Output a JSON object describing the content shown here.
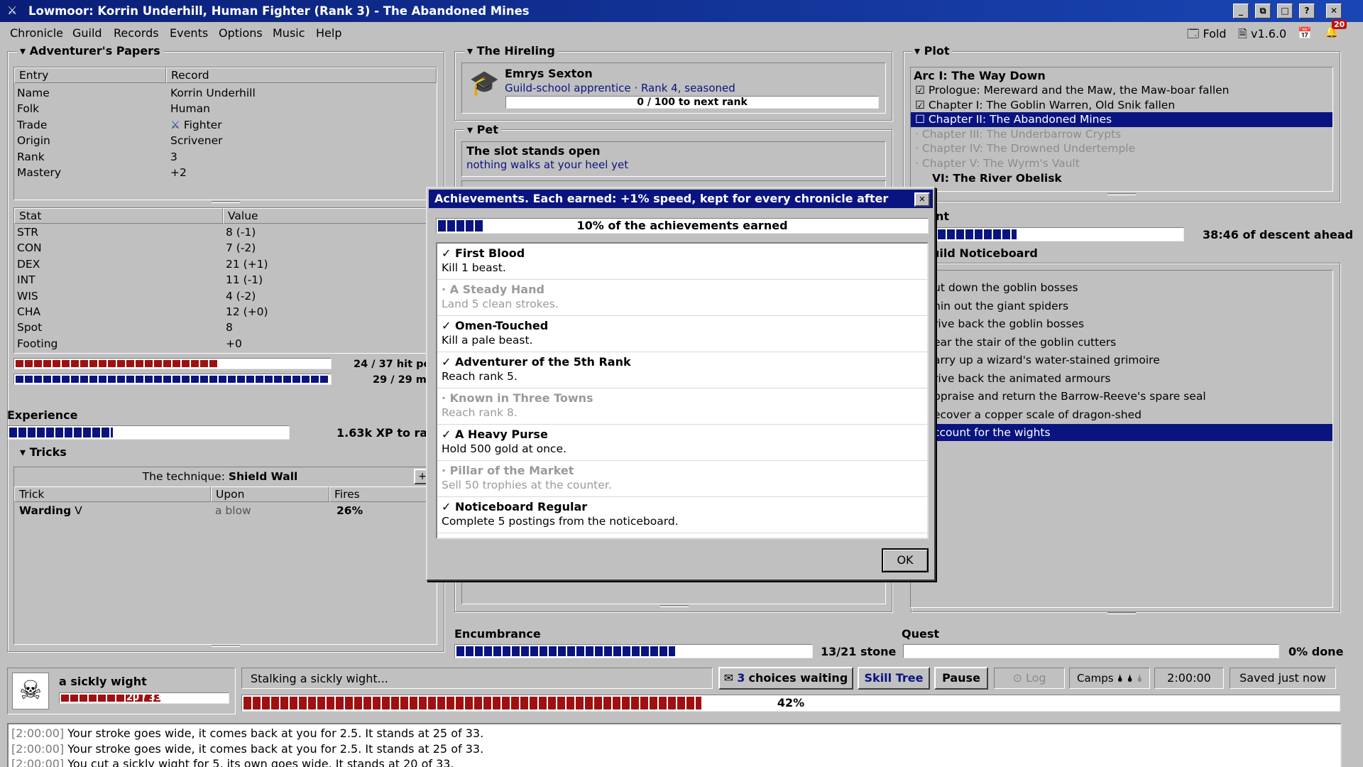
{
  "window": {
    "title": "Lowmoor: Korrin Underhill, Human Fighter (Rank 3) - The Abandoned Mines",
    "buttons": [
      "_",
      "⧉",
      "□",
      "?",
      "✕"
    ],
    "notification_count": "20"
  },
  "menu": [
    "Chronicle",
    "Guild",
    "Records",
    "Events",
    "Options",
    "Music",
    "Help"
  ],
  "menu_right": {
    "fold": "Fold",
    "version": "v1.6.0"
  },
  "papers": {
    "title": "Adventurer's Papers",
    "headers": [
      "Entry",
      "Record"
    ],
    "rows": [
      [
        "Name",
        "Korrin Underhill"
      ],
      [
        "Folk",
        "Human"
      ],
      [
        "Trade",
        "Fighter"
      ],
      [
        "Origin",
        "Scrivener"
      ],
      [
        "Rank",
        "3"
      ],
      [
        "Mastery",
        "+2"
      ]
    ]
  },
  "stats": {
    "headers": [
      "Stat",
      "Value"
    ],
    "rows": [
      [
        "STR",
        "8 (-1)"
      ],
      [
        "CON",
        "7 (-2)"
      ],
      [
        "DEX",
        "21 (+1)"
      ],
      [
        "INT",
        "11 (-1)"
      ],
      [
        "WIS",
        "4 (-2)"
      ],
      [
        "CHA",
        "12 (+0)"
      ],
      [
        "Spot",
        "8"
      ],
      [
        "Footing",
        "+0"
      ]
    ],
    "hp_text": "24 / 37 hit poin",
    "hp_fraction": 0.65,
    "mana_text": "29 / 29 ma",
    "mana_fraction": 1.0,
    "color_hp": "#a01010",
    "color_mana": "#0a1480"
  },
  "experience": {
    "label": "Experience",
    "text": "1.63k XP to ran",
    "fraction": 0.38
  },
  "tricks": {
    "title": "Tricks",
    "technique_label": "The technique: ",
    "technique_name": "Shield Wall",
    "add_button": "+",
    "headers": [
      "Trick",
      "Upon",
      "Fires"
    ],
    "row": {
      "name": "Warding",
      "level": "V",
      "upon": "a blow",
      "fires": "26%"
    }
  },
  "hireling": {
    "title": "The Hireling",
    "name": "Emrys Sexton",
    "desc": "Guild-school apprentice",
    "sep": "·",
    "rank": "Rank 4, seasoned",
    "progress_text": "0 / 100 to next rank",
    "fraction": 0
  },
  "pet": {
    "title": "Pet",
    "name": "The slot stands open",
    "desc": "nothing walks at your heel yet"
  },
  "plot": {
    "title": "Plot",
    "arc": "Arc I: The Way Down",
    "items": [
      {
        "mark": "☑",
        "text": "Prologue: Mereward and the Maw, the Maw-boar fallen",
        "state": "done"
      },
      {
        "mark": "☑",
        "text": "Chapter I: The Goblin Warren, Old Snik fallen",
        "state": "done"
      },
      {
        "mark": "☐",
        "text": "Chapter II: The Abandoned Mines",
        "state": "current"
      },
      {
        "mark": "·",
        "text": "Chapter III: The Underbarrow Crypts",
        "state": "locked"
      },
      {
        "mark": "·",
        "text": "Chapter IV: The Drowned Undertemple",
        "state": "locked"
      },
      {
        "mark": "·",
        "text": "Chapter V: The Wyrm's Vault",
        "state": "locked"
      },
      {
        "mark": "",
        "text": "VI: The River Obelisk",
        "state": "partial"
      }
    ]
  },
  "descent": {
    "title": "nt",
    "text": "38:46 of descent ahead",
    "fraction": 0.33
  },
  "noticeboard": {
    "title": "uild Noticeboard",
    "items": [
      "ut down the goblin bosses",
      "hin out the giant spiders",
      "rive back the goblin bosses",
      "ear the stair of the goblin cutters",
      "arry up a wizard's water-stained grimoire",
      "rive back the animated armours",
      "ppraise and return the Barrow-Reeve's spare seal",
      "ecover a copper scale of dragon-shed",
      "ccount for the wights"
    ]
  },
  "encumbrance": {
    "label": "Encumbrance",
    "text": "13/21 stone",
    "fraction": 0.62
  },
  "quest": {
    "label": "Quest",
    "text": "0% done",
    "fraction": 0
  },
  "enemy": {
    "name": "a sickly wight",
    "hp_text": "20 / 33",
    "fraction": 0.606
  },
  "status": {
    "action": "Stalking a sickly wight...",
    "choices_count": "3",
    "choices_label": "choices waiting",
    "skill_tree": "Skill Tree",
    "pause": "Pause",
    "log": "Log",
    "camps": "Camps",
    "time": "2:00:00",
    "saved": "Saved just now",
    "progress_text": "42%",
    "fraction": 0.42
  },
  "log": [
    {
      "ts": "[2:00:00]",
      "msg": "Your stroke goes wide, it comes back at you for 2.5. It stands at 25 of 33."
    },
    {
      "ts": "[2:00:00]",
      "msg": "Your stroke goes wide, it comes back at you for 2.5. It stands at 25 of 33."
    },
    {
      "ts": "[2:00:00]",
      "msg": "You cut a sickly wight for 5, its own goes wide. It stands at 20 of 33."
    }
  ],
  "dialog": {
    "title": "Achievements. Each earned: +1% speed, kept for every chronicle after",
    "close": "✕",
    "progress_text": "10% of the achievements earned",
    "fraction": 0.1,
    "check": "✓",
    "dot": "·",
    "items": [
      {
        "name": "First Blood",
        "desc": "Kill 1 beast.",
        "earned": true
      },
      {
        "name": "A Steady Hand",
        "desc": "Land 5 clean strokes.",
        "earned": false
      },
      {
        "name": "Omen-Touched",
        "desc": "Kill a pale beast.",
        "earned": true
      },
      {
        "name": "Adventurer of the 5th Rank",
        "desc": "Reach rank 5.",
        "earned": true
      },
      {
        "name": "Known in Three Towns",
        "desc": "Reach rank 8.",
        "earned": false
      },
      {
        "name": "A Heavy Purse",
        "desc": "Hold 500 gold at once.",
        "earned": true
      },
      {
        "name": "Pillar of the Market",
        "desc": "Sell 50 trophies at the counter.",
        "earned": false
      },
      {
        "name": "Noticeboard Regular",
        "desc": "Complete 5 postings from the noticeboard.",
        "earned": true
      }
    ],
    "ok": "OK"
  }
}
